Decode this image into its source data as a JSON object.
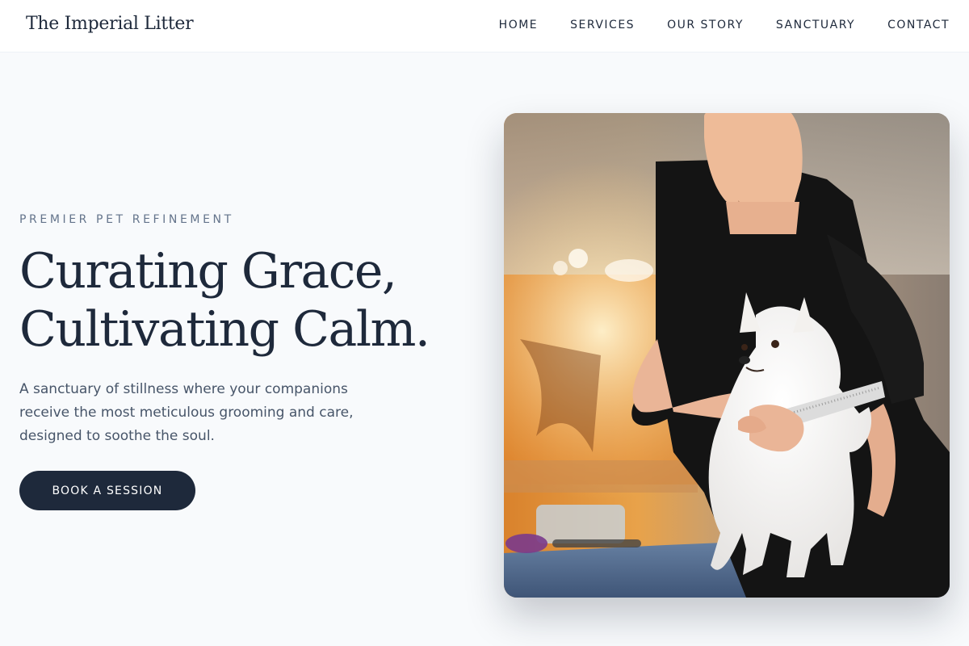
{
  "brand": {
    "name": "The Imperial Litter"
  },
  "nav": {
    "items": [
      {
        "label": "HOME"
      },
      {
        "label": "SERVICES"
      },
      {
        "label": "OUR STORY"
      },
      {
        "label": "SANCTUARY"
      },
      {
        "label": "CONTACT"
      }
    ]
  },
  "hero": {
    "eyebrow": "PREMIER PET REFINEMENT",
    "headline_line1": "Curating Grace,",
    "headline_line2": "Cultivating Calm.",
    "description": "A sanctuary of stillness where your companions receive the most meticulous grooming and care, designed to soothe the soul.",
    "cta_label": "BOOK A SESSION"
  },
  "colors": {
    "primary": "#1e293b",
    "page_background": "#f8fafc",
    "muted_text": "#64748b"
  }
}
